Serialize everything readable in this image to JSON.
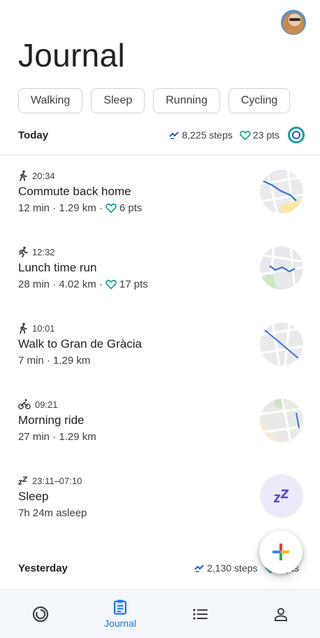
{
  "header": {
    "title": "Journal"
  },
  "chips": [
    "Walking",
    "Sleep",
    "Running",
    "Cycling"
  ],
  "today": {
    "label": "Today",
    "steps": "8,225 steps",
    "points": "23 pts"
  },
  "entries": [
    {
      "icon": "walk-icon",
      "time": "20:34",
      "name": "Commute back home",
      "duration": "12 min · 1.29 km ·",
      "points": "6 pts"
    },
    {
      "icon": "run-icon",
      "time": "12:32",
      "name": "Lunch time run",
      "duration": "28 min · 4.02 km ·",
      "points": "17 pts"
    },
    {
      "icon": "walk-icon",
      "time": "10:01",
      "name": "Walk to Gran de Gràcia",
      "duration": "7 min · 1.29 km",
      "points": ""
    },
    {
      "icon": "bike-icon",
      "time": "09:21",
      "name": "Morning ride",
      "duration": "27 min · 1.29 km",
      "points": ""
    },
    {
      "icon": "sleep-icon",
      "time": "23:11–07:10",
      "name": "Sleep",
      "duration": "7h 24m asleep",
      "points": ""
    }
  ],
  "yesterday": {
    "label": "Yesterday",
    "steps": "2,130 steps",
    "points": "0 pts"
  },
  "nav": {
    "journal_label": "Journal"
  },
  "colors": {
    "accent": "#1a73e8",
    "teal": "#1aa299",
    "sleep_bg": "#ede9fb",
    "sleep_icon": "#5b4bc4"
  }
}
